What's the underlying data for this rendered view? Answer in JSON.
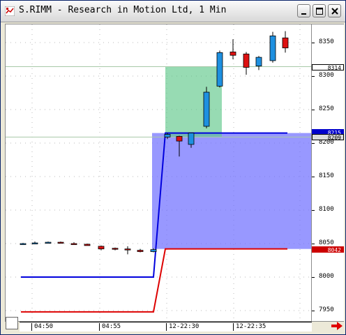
{
  "window": {
    "title": "S.RIMM - Research in Motion Ltd, 1 Min",
    "icons": {
      "app": "chart-app-icon",
      "minimize": "minimize-icon",
      "maximize": "maximize-icon",
      "close": "close-icon",
      "scroll": "right-arrow-icon"
    }
  },
  "price_axis": {
    "ticks": [
      "8350",
      "8300",
      "8250",
      "8200",
      "8150",
      "8100",
      "8050",
      "8000",
      "7950"
    ],
    "tags": [
      {
        "label": "8314",
        "bg": "#ffffff",
        "fg": "#000000",
        "border": "#000000"
      },
      {
        "label": "8215",
        "bg": "#0000cc",
        "fg": "#ffffff",
        "border": "#0000cc"
      },
      {
        "label": "8209",
        "bg": "#dcdcdc",
        "fg": "#000000",
        "border": "#000000"
      },
      {
        "label": "8042",
        "bg": "#cc0000",
        "fg": "#ffffff",
        "border": "#cc0000"
      }
    ]
  },
  "time_axis": {
    "ticks": [
      "04:50",
      "04:55",
      "12-22:30",
      "12-22:35"
    ]
  },
  "colors": {
    "up_candle": "#1e90e0",
    "down_candle": "#dd1111",
    "blue_line": "#0000dd",
    "red_line": "#dd0000",
    "blue_zone": "#7070ff",
    "green_zone": "#5fc88a"
  },
  "chart_data": {
    "type": "candlestick",
    "candles": [
      {
        "o": 8050,
        "h": 8051,
        "l": 8048,
        "c": 8050
      },
      {
        "o": 8051,
        "h": 8053,
        "l": 8049,
        "c": 8051
      },
      {
        "o": 8051,
        "h": 8053,
        "l": 8050,
        "c": 8052
      },
      {
        "o": 8052,
        "h": 8053,
        "l": 8050,
        "c": 8051
      },
      {
        "o": 8050,
        "h": 8052,
        "l": 8049,
        "c": 8049
      },
      {
        "o": 8049,
        "h": 8050,
        "l": 8047,
        "c": 8047
      },
      {
        "o": 8046,
        "h": 8047,
        "l": 8040,
        "c": 8042
      },
      {
        "o": 8043,
        "h": 8044,
        "l": 8040,
        "c": 8042
      },
      {
        "o": 8042,
        "h": 8046,
        "l": 8034,
        "c": 8041
      },
      {
        "o": 8040,
        "h": 8042,
        "l": 8037,
        "c": 8038
      },
      {
        "o": 8038,
        "h": 8043,
        "l": 8037,
        "c": 8041
      },
      {
        "o": 8209,
        "h": 8215,
        "l": 8206,
        "c": 8213
      },
      {
        "o": 8210,
        "h": 8211,
        "l": 8180,
        "c": 8203
      },
      {
        "o": 8198,
        "h": 8215,
        "l": 8193,
        "c": 8215
      },
      {
        "o": 8225,
        "h": 8284,
        "l": 8222,
        "c": 8276
      },
      {
        "o": 8285,
        "h": 8338,
        "l": 8283,
        "c": 8335
      },
      {
        "o": 8336,
        "h": 8355,
        "l": 8325,
        "c": 8331
      },
      {
        "o": 8333,
        "h": 8336,
        "l": 8302,
        "c": 8313
      },
      {
        "o": 8315,
        "h": 8330,
        "l": 8309,
        "c": 8328
      },
      {
        "o": 8323,
        "h": 8366,
        "l": 8320,
        "c": 8360
      },
      {
        "o": 8357,
        "h": 8367,
        "l": 8335,
        "c": 8342
      }
    ],
    "blue_line": [
      8000,
      8000,
      8215,
      8215
    ],
    "red_line": [
      7948,
      7948,
      8042,
      8042
    ],
    "blue_zone": {
      "top": 8215,
      "bottom": 8042
    },
    "green_zone": {
      "top": 8314,
      "bottom": 8209
    },
    "hlines": [
      8314,
      8209
    ],
    "ylim": [
      7930,
      8380
    ]
  }
}
